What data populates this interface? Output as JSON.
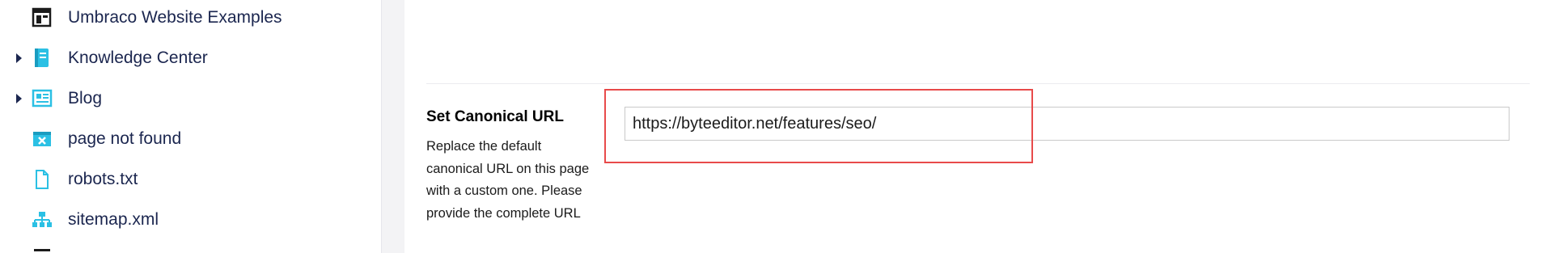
{
  "tree": {
    "items": [
      {
        "label": "Umbraco Website Examples",
        "icon": "layout-icon",
        "expandable": false
      },
      {
        "label": "Knowledge Center",
        "icon": "book-icon",
        "expandable": true
      },
      {
        "label": "Blog",
        "icon": "newspaper-icon",
        "expandable": true
      },
      {
        "label": "page not found",
        "icon": "broken-window-icon",
        "expandable": false
      },
      {
        "label": "robots.txt",
        "icon": "document-icon",
        "expandable": false
      },
      {
        "label": "sitemap.xml",
        "icon": "sitemap-icon",
        "expandable": false
      }
    ],
    "icon_color": "#2bc0e4",
    "text_color": "#1b264f"
  },
  "property": {
    "label": "Set Canonical URL",
    "description": "Replace the default canonical URL on this page with a custom one. Please provide the complete URL",
    "value": "https://byteeditor.net/features/seo/"
  },
  "colors": {
    "highlight": "#e84a4a",
    "editor_background": "#f3f3f5"
  }
}
